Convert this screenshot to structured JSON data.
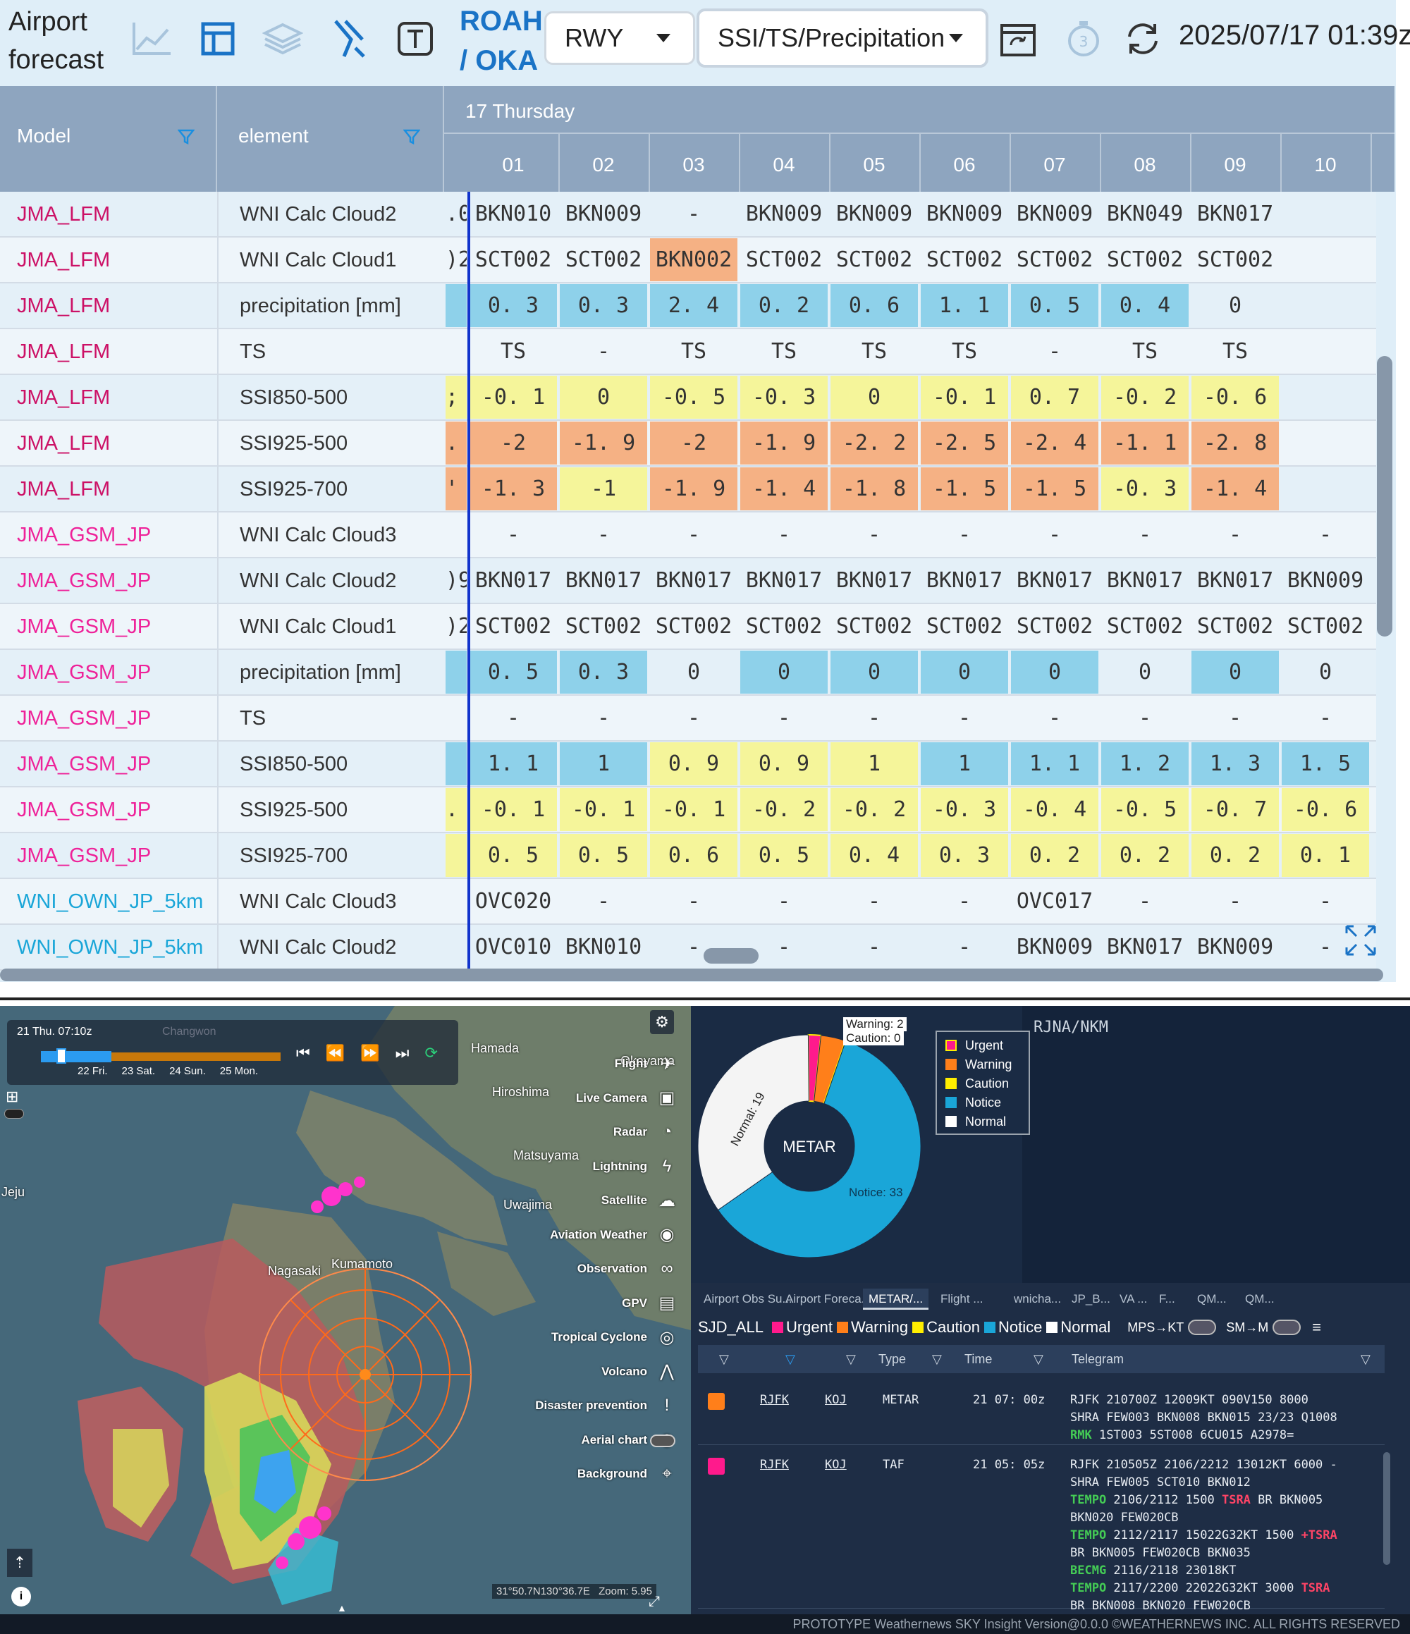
{
  "toolbar": {
    "app_title_line1": "Airport",
    "app_title_line2": "forecast",
    "icons": [
      "line-chart-icon",
      "table-icon",
      "layers-icon",
      "runway-icon",
      "text-icon",
      "calendar-sync-icon",
      "timer-icon",
      "refresh-icon"
    ],
    "airport_line1": "ROAH",
    "airport_line2": "/ OKA",
    "runway_select": "RWY",
    "element_select": "SSI/TS/Precipitation",
    "datetime": "2025/07/17 01:39z"
  },
  "grid": {
    "col_model": "Model",
    "col_element": "element",
    "day_label": "17 Thursday",
    "hours": [
      "01",
      "02",
      "03",
      "04",
      "05",
      "06",
      "07",
      "08",
      "09",
      "10"
    ],
    "colors": {
      "blue": "#8ed1ea",
      "yellow": "#f5f59a",
      "orange": "#f5b184",
      "model_pink": "#cc1166",
      "model_magenta": "#ee2299",
      "model_cyan": "#1aa6d8"
    },
    "rows": [
      {
        "model": "JMA_LFM",
        "element": "WNI Calc Cloud2",
        "pre": ".0",
        "values": [
          "BKN010",
          "BKN009",
          "-",
          "BKN009",
          "BKN009",
          "BKN009",
          "BKN009",
          "BKN049",
          "BKN017",
          ""
        ],
        "colors": [
          "",
          "",
          "",
          "",
          "",
          "",
          "",
          "",
          "",
          ""
        ]
      },
      {
        "model": "JMA_LFM",
        "element": "WNI Calc Cloud1",
        "pre": ")2",
        "values": [
          "SCT002",
          "SCT002",
          "BKN002",
          "SCT002",
          "SCT002",
          "SCT002",
          "SCT002",
          "SCT002",
          "SCT002",
          ""
        ],
        "colors": [
          "",
          "",
          "o",
          "",
          "",
          "",
          "",
          "",
          "",
          ""
        ]
      },
      {
        "model": "JMA_LFM",
        "element": "precipitation [mm]",
        "pre": "",
        "values": [
          "0. 3",
          "0. 3",
          "2. 4",
          "0. 2",
          "0. 6",
          "1. 1",
          "0. 5",
          "0. 4",
          "0",
          ""
        ],
        "colors": [
          "b",
          "b",
          "b",
          "b",
          "b",
          "b",
          "b",
          "b",
          "",
          ""
        ]
      },
      {
        "model": "JMA_LFM",
        "element": "TS",
        "pre": "",
        "values": [
          "TS",
          "-",
          "TS",
          "TS",
          "TS",
          "TS",
          "-",
          "TS",
          "TS",
          ""
        ],
        "colors": [
          "",
          "",
          "",
          "",
          "",
          "",
          "",
          "",
          "",
          ""
        ]
      },
      {
        "model": "JMA_LFM",
        "element": "SSI850-500",
        "pre": ";",
        "values": [
          "-0. 1",
          "0",
          "-0. 5",
          "-0. 3",
          "0",
          "-0. 1",
          "0. 7",
          "-0. 2",
          "-0. 6",
          ""
        ],
        "colors": [
          "y",
          "y",
          "y",
          "y",
          "y",
          "y",
          "y",
          "y",
          "y",
          ""
        ]
      },
      {
        "model": "JMA_LFM",
        "element": "SSI925-500",
        "pre": ".",
        "values": [
          "-2",
          "-1. 9",
          "-2",
          "-1. 9",
          "-2. 2",
          "-2. 5",
          "-2. 4",
          "-1. 1",
          "-2. 8",
          ""
        ],
        "colors": [
          "o",
          "o",
          "o",
          "o",
          "o",
          "o",
          "o",
          "o",
          "o",
          ""
        ]
      },
      {
        "model": "JMA_LFM",
        "element": "SSI925-700",
        "pre": "'",
        "values": [
          "-1. 3",
          "-1",
          "-1. 9",
          "-1. 4",
          "-1. 8",
          "-1. 5",
          "-1. 5",
          "-0. 3",
          "-1. 4",
          ""
        ],
        "colors": [
          "o",
          "y",
          "o",
          "o",
          "o",
          "o",
          "o",
          "y",
          "o",
          ""
        ]
      },
      {
        "model": "JMA_GSM_JP",
        "element": "WNI Calc Cloud3",
        "pre": "",
        "values": [
          "-",
          "-",
          "-",
          "-",
          "-",
          "-",
          "-",
          "-",
          "-",
          "-"
        ],
        "colors": [
          "",
          "",
          "",
          "",
          "",
          "",
          "",
          "",
          "",
          ""
        ]
      },
      {
        "model": "JMA_GSM_JP",
        "element": "WNI Calc Cloud2",
        "pre": ")9",
        "values": [
          "BKN017",
          "BKN017",
          "BKN017",
          "BKN017",
          "BKN017",
          "BKN017",
          "BKN017",
          "BKN017",
          "BKN017",
          "BKN009"
        ],
        "colors": [
          "",
          "",
          "",
          "",
          "",
          "",
          "",
          "",
          "",
          ""
        ]
      },
      {
        "model": "JMA_GSM_JP",
        "element": "WNI Calc Cloud1",
        "pre": ")2",
        "values": [
          "SCT002",
          "SCT002",
          "SCT002",
          "SCT002",
          "SCT002",
          "SCT002",
          "SCT002",
          "SCT002",
          "SCT002",
          "SCT002"
        ],
        "colors": [
          "",
          "",
          "",
          "",
          "",
          "",
          "",
          "",
          "",
          ""
        ]
      },
      {
        "model": "JMA_GSM_JP",
        "element": "precipitation [mm]",
        "pre": "",
        "values": [
          "0. 5",
          "0. 3",
          "0",
          "0",
          "0",
          "0",
          "0",
          "0",
          "0",
          "0"
        ],
        "colors": [
          "b",
          "b",
          "",
          "b",
          "b",
          "b",
          "b",
          "",
          "b",
          ""
        ]
      },
      {
        "model": "JMA_GSM_JP",
        "element": "TS",
        "pre": "",
        "values": [
          "-",
          "-",
          "-",
          "-",
          "-",
          "-",
          "-",
          "-",
          "-",
          "-"
        ],
        "colors": [
          "",
          "",
          "",
          "",
          "",
          "",
          "",
          "",
          "",
          ""
        ]
      },
      {
        "model": "JMA_GSM_JP",
        "element": "SSI850-500",
        "pre": "",
        "values": [
          "1. 1",
          "1",
          "0. 9",
          "0. 9",
          "1",
          "1",
          "1. 1",
          "1. 2",
          "1. 3",
          "1. 5"
        ],
        "colors": [
          "b",
          "b",
          "y",
          "y",
          "y",
          "b",
          "b",
          "b",
          "b",
          "b"
        ]
      },
      {
        "model": "JMA_GSM_JP",
        "element": "SSI925-500",
        "pre": ".",
        "values": [
          "-0. 1",
          "-0. 1",
          "-0. 1",
          "-0. 2",
          "-0. 2",
          "-0. 3",
          "-0. 4",
          "-0. 5",
          "-0. 7",
          "-0. 6"
        ],
        "colors": [
          "y",
          "y",
          "y",
          "y",
          "y",
          "y",
          "y",
          "y",
          "y",
          "y"
        ]
      },
      {
        "model": "JMA_GSM_JP",
        "element": "SSI925-700",
        "pre": "",
        "values": [
          "0. 5",
          "0. 5",
          "0. 6",
          "0. 5",
          "0. 4",
          "0. 3",
          "0. 2",
          "0. 2",
          "0. 2",
          "0. 1"
        ],
        "colors": [
          "y",
          "y",
          "y",
          "y",
          "y",
          "y",
          "y",
          "y",
          "y",
          "y"
        ]
      },
      {
        "model": "WNI_OWN_JP_5km",
        "element": "WNI Calc Cloud3",
        "pre": "",
        "values": [
          "OVC020",
          "-",
          "-",
          "-",
          "-",
          "-",
          "OVC017",
          "-",
          "-",
          "-"
        ],
        "colors": [
          "",
          "",
          "",
          "",
          "",
          "",
          "",
          "",
          "",
          ""
        ]
      },
      {
        "model": "WNI_OWN_JP_5km",
        "element": "WNI Calc Cloud2",
        "pre": "",
        "values": [
          "OVC010",
          "BKN010",
          "-",
          "-",
          "-",
          "-",
          "BKN009",
          "BKN017",
          "BKN009",
          "-"
        ],
        "colors": [
          "",
          "",
          "",
          "",
          "",
          "",
          "",
          "",
          "",
          ""
        ]
      }
    ]
  },
  "map": {
    "time_label": "21 Thu. 07:10z",
    "time_top_faint": "Changwon",
    "days": [
      "22 Fri.",
      "23 Sat.",
      "24 Sun.",
      "25 Mon."
    ],
    "places": [
      "Hamada",
      "Okayama",
      "Hiroshima",
      "Matsuyama",
      "Uwajima",
      "Nagasaki",
      "Kumamoto",
      "Jeju"
    ],
    "layers": [
      {
        "label": "Flight",
        "icon": "airplane-icon"
      },
      {
        "label": "Live Camera",
        "icon": "camera-icon"
      },
      {
        "label": "Radar",
        "icon": "radar-icon"
      },
      {
        "label": "Lightning",
        "icon": "lightning-icon"
      },
      {
        "label": "Satellite",
        "icon": "satellite-icon"
      },
      {
        "label": "Aviation Weather",
        "icon": "globe-icon"
      },
      {
        "label": "Observation",
        "icon": "binoculars-icon"
      },
      {
        "label": "GPV",
        "icon": "database-icon"
      },
      {
        "label": "Tropical Cyclone",
        "icon": "cyclone-icon"
      },
      {
        "label": "Volcano",
        "icon": "volcano-icon"
      },
      {
        "label": "Disaster prevention",
        "icon": "exclamation-icon"
      },
      {
        "label": "Aerial chart",
        "icon": "chart-globe-icon"
      },
      {
        "label": "Background",
        "icon": "pin-icon"
      }
    ],
    "coords": "31°50.7N130°36.7E",
    "zoom": "Zoom: 5.95"
  },
  "pie": {
    "center": "METAR",
    "warning_label": "Warning: 2",
    "caution_label": "Caution: 0",
    "normal_label": "Normal: 19",
    "notice_label": "Notice: 33",
    "slices": [
      {
        "name": "Urgent",
        "value": 1,
        "color": "#ff1a8c"
      },
      {
        "name": "Warning",
        "value": 2,
        "color": "#ff7f1a"
      },
      {
        "name": "Caution",
        "value": 0,
        "color": "#ffee00"
      },
      {
        "name": "Notice",
        "value": 33,
        "color": "#1aa6d8"
      },
      {
        "name": "Normal",
        "value": 19,
        "color": "#f4f4f4"
      }
    ],
    "legend": [
      "Urgent",
      "Warning",
      "Caution",
      "Notice",
      "Normal"
    ],
    "side_title": "RJNA/NKM"
  },
  "metar": {
    "tabs": [
      "Airport Obs Su...",
      "Airport Foreca...",
      "METAR/...",
      "Flight ...",
      "wnicha...",
      "JP_B...",
      "VA ...",
      "F...",
      "QM...",
      "QM..."
    ],
    "group": "SJD_ALL",
    "filters": [
      "Urgent",
      "Warning",
      "Caution",
      "Notice",
      "Normal"
    ],
    "toggle1": "MPS→KT",
    "toggle2": "SM→M",
    "headers": {
      "type": "Type",
      "time": "Time",
      "telegram": "Telegram"
    },
    "rows": [
      {
        "color": "#ff7f1a",
        "icao": "RJFK",
        "iata": "KOJ",
        "type": "METAR",
        "time": "21 07: 00z",
        "telegram": [
          "RJFK 210700Z 12009KT 090V150 8000",
          "SHRA FEW003 BKN008 BKN015 23/23 Q1008",
          "RMK 1ST003 5ST008 6CU015 A2978="
        ]
      },
      {
        "color": "#ff1a8c",
        "icao": "RJFK",
        "iata": "KOJ",
        "type": "TAF",
        "time": "21 05: 05z",
        "telegram": [
          "RJFK 210505Z 2106/2212 13012KT 6000 -",
          "SHRA FEW005 SCT010 BKN012",
          "TEMPO 2106/2112 1500 TSRA BR BKN005",
          "BKN020 FEW020CB",
          "TEMPO 2112/2117 15022G32KT 1500 +TSRA",
          "BR BKN005 FEW020CB BKN035",
          "BECMG 2116/2118 23018KT",
          "TEMPO 2117/2200 22022G32KT 3000 TSRA",
          "BR BKN008 BKN020 FEW020CB"
        ]
      }
    ]
  },
  "footer": "PROTOTYPE Weathernews SKY Insight  Version@0.0.0  ©WEATHERNEWS INC. ALL RIGHTS RESERVED"
}
